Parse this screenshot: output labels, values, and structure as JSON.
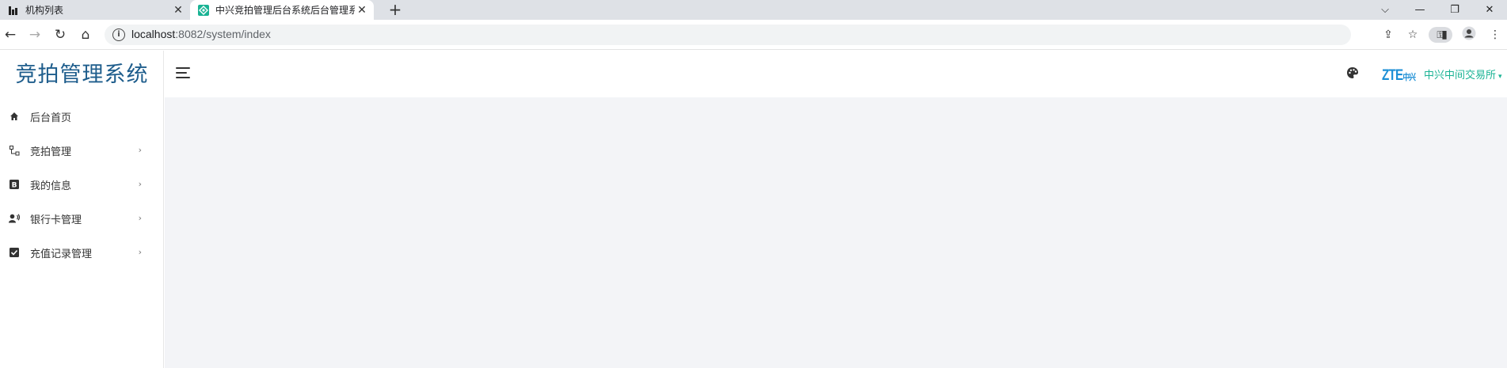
{
  "browser": {
    "tabs": [
      {
        "title": "机构列表",
        "active": false
      },
      {
        "title": "中兴竞拍管理后台系统后台管理系",
        "active": true
      }
    ],
    "new_tab_icon": "plus-icon",
    "address_bar": {
      "host": "localhost",
      "path": ":8082/system/index"
    },
    "window_controls": [
      "chevron-down-icon",
      "minimize-icon",
      "restore-icon",
      "close-icon"
    ]
  },
  "app": {
    "brand": "竞拍管理系统",
    "menu": [
      {
        "label": "后台首页",
        "icon": "home-icon",
        "has_submenu": false
      },
      {
        "label": "竞拍管理",
        "icon": "sitemap-icon",
        "has_submenu": true
      },
      {
        "label": "我的信息",
        "icon": "bold-b-icon",
        "has_submenu": true
      },
      {
        "label": "银行卡管理",
        "icon": "user-voice-icon",
        "has_submenu": true
      },
      {
        "label": "充值记录管理",
        "icon": "check-square-icon",
        "has_submenu": true
      }
    ],
    "header": {
      "logo_text": "ZTE",
      "logo_suffix": "中兴",
      "user_name": "中兴中间交易所"
    }
  },
  "colors": {
    "brand": "#1e5d8c",
    "accent": "#1ab394",
    "content_bg": "#f3f4f7",
    "zte_blue": "#1c8fd6"
  }
}
